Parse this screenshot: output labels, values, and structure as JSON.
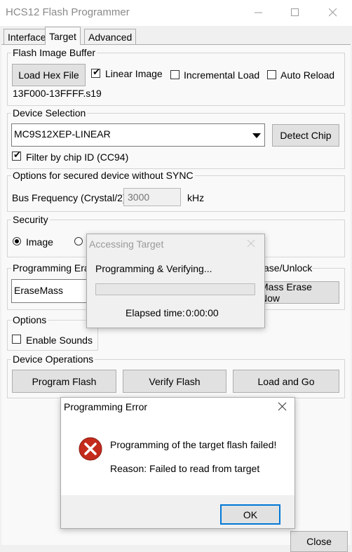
{
  "window": {
    "title": "HCS12 Flash Programmer",
    "close_label": "Close"
  },
  "tabs": [
    "Interface",
    "Target",
    "Advanced"
  ],
  "flash_image": {
    "group_label": "Flash Image Buffer",
    "load_button": "Load Hex File",
    "linear_image": "Linear Image",
    "incremental_load": "Incremental Load",
    "auto_reload": "Auto Reload",
    "filename": "13F000-13FFFF.s19"
  },
  "device": {
    "group_label": "Device Selection",
    "selected": "MC9S12XEP-LINEAR",
    "detect_button": "Detect Chip",
    "filter_label": "Filter by chip ID (CC94)"
  },
  "secured": {
    "group_label": "Options for secured device without SYNC",
    "bus_label": "Bus Frequency (Crystal/2)",
    "bus_placeholder": "3000",
    "unit": "kHz"
  },
  "security": {
    "group_label": "Security",
    "image_label": "Image"
  },
  "programming": {
    "group_label_left": "Programming Era",
    "group_label_right": "ase/Unlock",
    "erase_mode": "EraseMass",
    "mass_erase_button": "Mass Erase Now"
  },
  "options": {
    "group_label": "Options",
    "enable_sounds": "Enable Sounds"
  },
  "operations": {
    "group_label": "Device Operations",
    "program_button": "Program Flash",
    "verify_button": "Verify Flash",
    "load_go_button": "Load and Go"
  },
  "accessing_dialog": {
    "title": "Accessing Target",
    "status": "Programming & Verifying...",
    "elapsed_label": "Elapsed time:",
    "elapsed_value": "0:00:00",
    "progress": 0
  },
  "error_dialog": {
    "title": "Programming Error",
    "message": "Programming of the target flash failed!",
    "reason": "Reason: Failed to read from target",
    "ok_label": "OK"
  },
  "colors": {
    "error_red": "#c42b1c",
    "focus_blue": "#0078d7"
  }
}
